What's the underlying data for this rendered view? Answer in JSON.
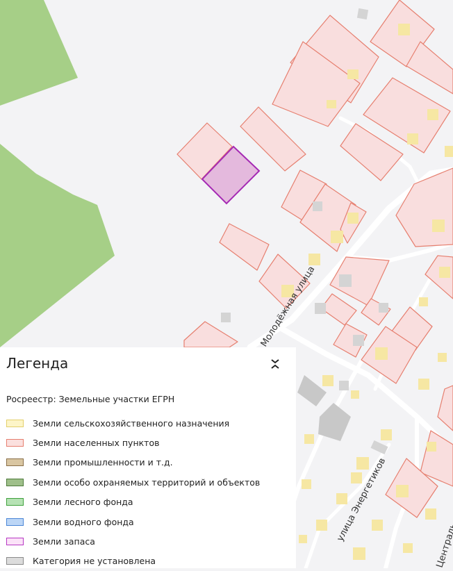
{
  "map": {
    "streets": [
      {
        "id": "molodezhnaya",
        "name": "Молодёжная улица"
      },
      {
        "id": "energetikov",
        "name": "улица Энергетиков"
      },
      {
        "id": "centralnaya",
        "name": "Централь..."
      }
    ],
    "colors": {
      "background": "#f3f3f5",
      "forest": "#a6cf87",
      "settlement_fill": "#f9dede",
      "settlement_stroke": "#e67f6f",
      "reserve_fill": "#e4b9dd",
      "reserve_stroke": "#a52ab4",
      "building_yellow": "#f6e7a3",
      "building_gray": "#d4d4d4",
      "road": "#ffffff"
    }
  },
  "legend": {
    "title": "Легенда",
    "collapse_icon": "chevron-collapse-icon",
    "subtitle": "Росреестр: Земельные участки ЕГРН",
    "items": [
      {
        "label": "Земли сельскохозяйственного назначения",
        "fill": "#fdf5c8",
        "stroke": "#e3cf6b"
      },
      {
        "label": "Земли населенных пунктов",
        "fill": "#fbe0de",
        "stroke": "#e67f6f"
      },
      {
        "label": "Земли промышленности и т.д.",
        "fill": "#d9c6a2",
        "stroke": "#8a6f48"
      },
      {
        "label": "Земли особо охраняемых территорий и объектов",
        "fill": "#9fbf8a",
        "stroke": "#4d7a3a"
      },
      {
        "label": "Земли лесного фонда",
        "fill": "#b6e2b4",
        "stroke": "#3fa13c"
      },
      {
        "label": "Земли водного фонда",
        "fill": "#bcd6f6",
        "stroke": "#4b86d6"
      },
      {
        "label": "Земли запаса",
        "fill": "#fbe2f8",
        "stroke": "#b637c4"
      },
      {
        "label": "Категория не установлена",
        "fill": "#dcdcdc",
        "stroke": "#8a8a8a"
      }
    ]
  }
}
